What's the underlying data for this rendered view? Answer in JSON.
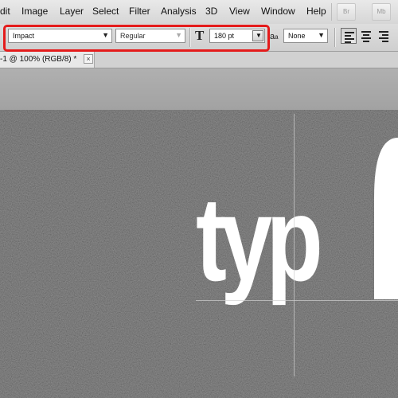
{
  "menu": {
    "items": [
      "dit",
      "Image",
      "Layer",
      "Select",
      "Filter",
      "Analysis",
      "3D",
      "View",
      "Window",
      "Help"
    ],
    "bridge_button": "Br",
    "minibridge_button": "Mb"
  },
  "options": {
    "font_family": "Impact",
    "font_style": "Regular",
    "font_size_icon": "T",
    "font_size": "180 pt",
    "antialias_icon": "a",
    "antialias_icon_small": "a",
    "antialias": "None",
    "dropdown_arrow": "▼"
  },
  "document": {
    "tab_title": "-1 @ 100% (RGB/8) *",
    "close_symbol": "×"
  },
  "canvas": {
    "text": "typ"
  },
  "colors": {
    "highlight": "#e41b1b",
    "canvas_bg": "#2c2c2c"
  }
}
